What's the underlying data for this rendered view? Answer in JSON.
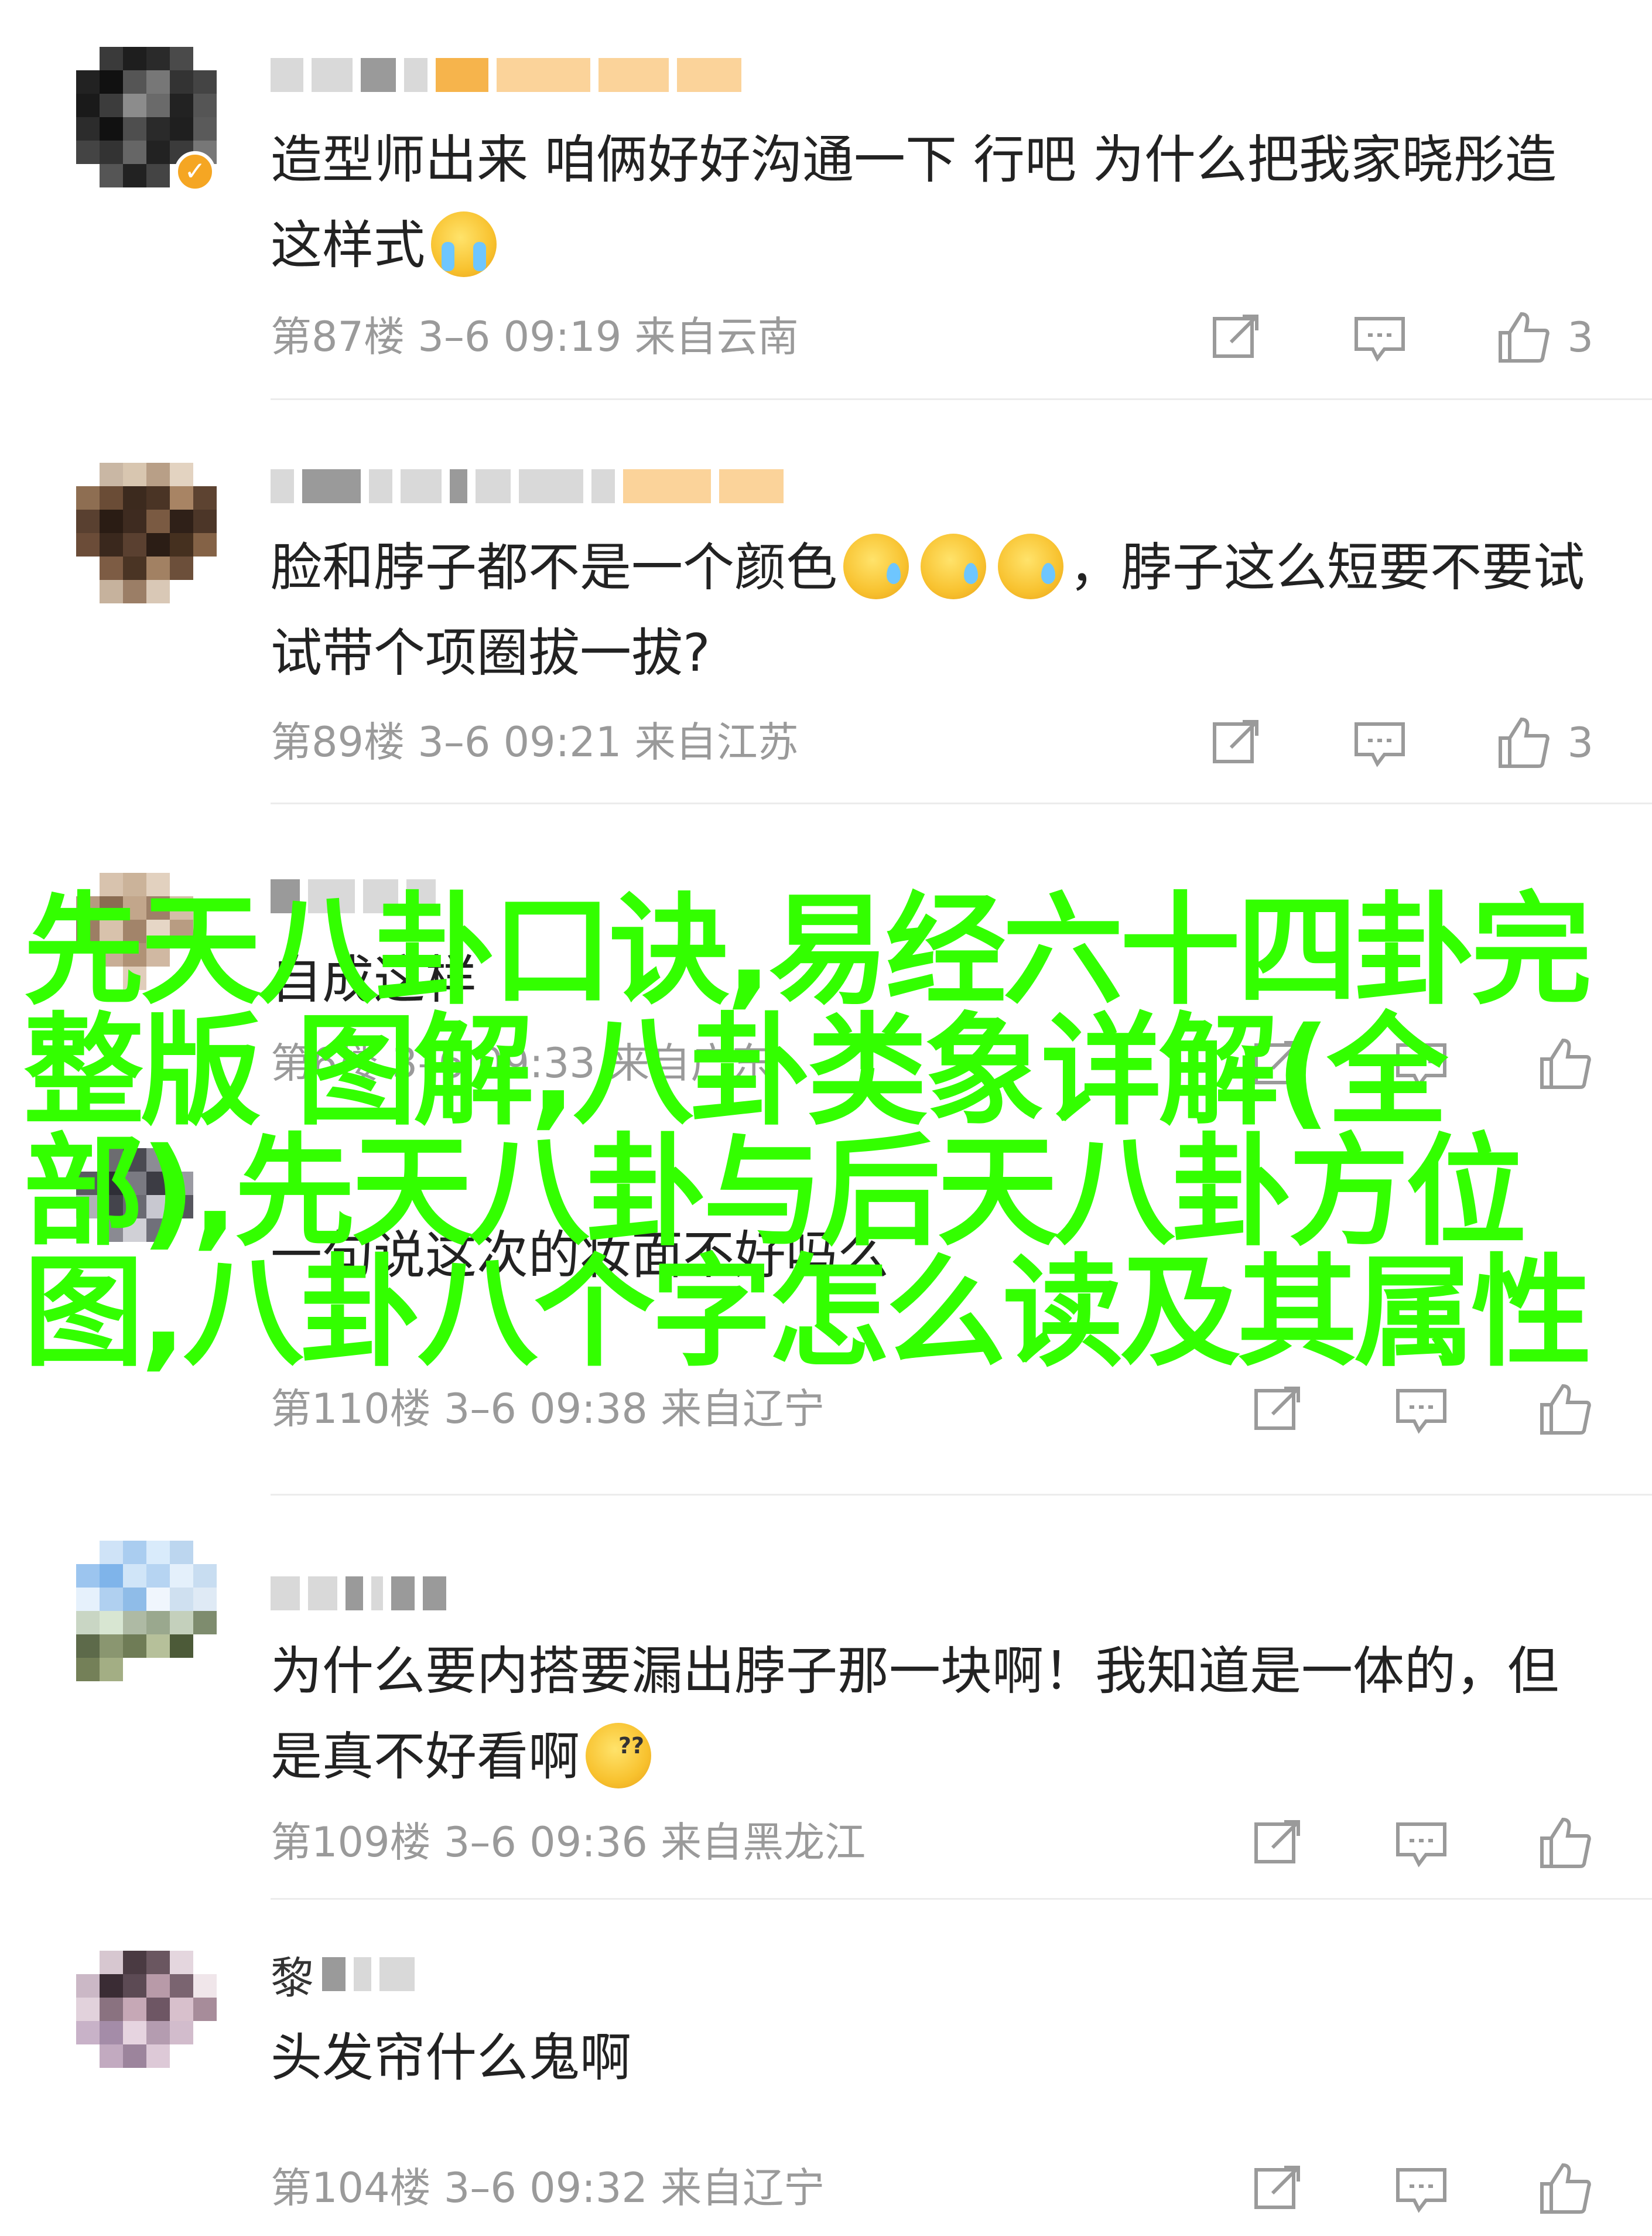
{
  "comments": [
    {
      "author_masked": true,
      "verified": true,
      "body": "造型师出来 咱俩好好沟通一下 行吧 为什么把我家晓彤造这样式",
      "emoji": "loudly-crying-face",
      "meta": "第87楼 3–6 09:19 来自云南",
      "likes": "3"
    },
    {
      "author_masked": true,
      "body_before": "脸和脖子都不是一个颜色",
      "emoji": [
        "sweat-face",
        "sweat-face",
        "sweat-face"
      ],
      "body_after": "，脖子这么短要不要试试带个项圈拔一拔?",
      "meta": "第89楼 3–6 09:21 来自江苏",
      "likes": "3"
    },
    {
      "author_masked": true,
      "body": "自成这样",
      "meta": "第6楼 3–6 09:33 来自广东",
      "likes": ""
    },
    {
      "author_masked": true,
      "body": "一句说这次的妆面不好吗么",
      "meta": "第110楼 3–6 09:38 来自辽宁",
      "likes": ""
    },
    {
      "author_masked": true,
      "body": "为什么要内搭要漏出脖子那一块啊！我知道是一体的，但是真不好看啊",
      "emoji": "dizzy-face",
      "meta": "第109楼 3–6 09:36 来自黑龙江",
      "likes": ""
    },
    {
      "author_prefix": "黎",
      "body": "头发帘什么鬼啊",
      "meta": "第104楼 3–6 09:32 来自辽宁",
      "likes": ""
    }
  ],
  "overlay_text": "先天八卦口诀,易经六十四卦完整版 图解,八卦类象详解(全部),先天八卦与后天八卦方位图,八卦八个字怎么读及其属性",
  "icons": {
    "share": "share-icon",
    "reply": "comment-icon",
    "like": "thumbs-up-icon"
  },
  "colors": {
    "meta_text": "#9a9a9a",
    "overlay": "#33ff00",
    "verified_badge": "#f5a623"
  }
}
